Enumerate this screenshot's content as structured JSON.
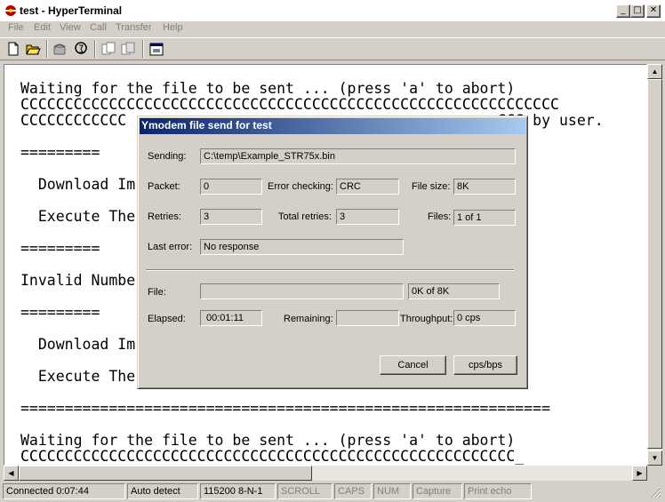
{
  "window": {
    "title": "test - HyperTerminal",
    "min_label": "_",
    "max_label": "□",
    "close_label": "✕"
  },
  "menu": [
    "File",
    "Edit",
    "View",
    "Call",
    "Transfer",
    "Help"
  ],
  "terminal": {
    "lines": [
      "Waiting for the file to be sent ... (press 'a' to abort)",
      "CCCCCCCCCCCCCCCCCCCCCCCCCCCCCCCCCCCCCCCCCCCCCCCCCCCCCCCCCCCCC",
      "CCCCCCCCCCCC                                          CCC by user.",
      "",
      "=========                                          ",
      "",
      "  Download Im                                          1",
      "",
      "  Execute The                                          2",
      "",
      "=========                                          =",
      "",
      "Invalid Numbe",
      "",
      "=========",
      "",
      "  Download Im                                          1",
      "",
      "  Execute The                                          2",
      "",
      "============================================================",
      "",
      "Waiting for the file to be sent ... (press 'a' to abort)",
      "CCCCCCCCCCCCCCCCCCCCCCCCCCCCCCCCCCCCCCCCCCCCCCCCCCCCCCCC_"
    ]
  },
  "dialog": {
    "title": "Ymodem file send for test",
    "sending_label": "Sending:",
    "sending_value": "C:\\temp\\Example_STR75x.bin",
    "packet_label": "Packet:",
    "packet_value": "0",
    "error_checking_label": "Error checking:",
    "error_checking_value": "CRC",
    "file_size_label": "File size:",
    "file_size_value": "8K",
    "retries_label": "Retries:",
    "retries_value": "3",
    "total_retries_label": "Total retries:",
    "total_retries_value": "3",
    "files_label": "Files:",
    "files_value": "1 of 1",
    "last_error_label": "Last error:",
    "last_error_value": "No response",
    "file_label": "File:",
    "file_progress_text": "0K of 8K",
    "file_progress": 0,
    "elapsed_label": "Elapsed:",
    "elapsed_value": "00:01:11",
    "remaining_label": "Remaining:",
    "remaining_value": "",
    "throughput_label": "Throughput:",
    "throughput_value": "0 cps",
    "cancel_label": "Cancel",
    "cps_label": "cps/bps"
  },
  "status": {
    "connected": "Connected 0:07:44",
    "detect": "Auto detect",
    "settings": "115200 8-N-1",
    "scroll": "SCROLL",
    "caps": "CAPS",
    "num": "NUM",
    "capture": "Capture",
    "print_echo": "Print echo"
  }
}
